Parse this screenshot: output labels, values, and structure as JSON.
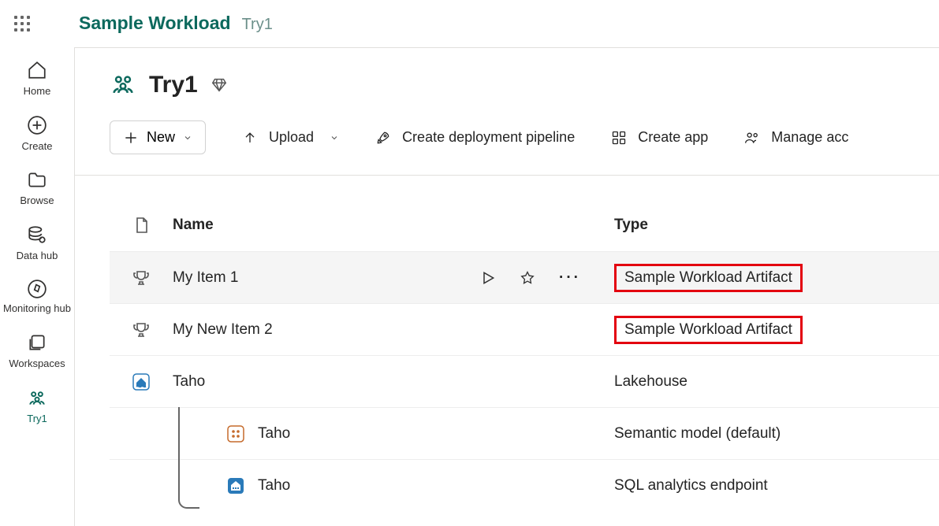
{
  "breadcrumb": {
    "main": "Sample Workload",
    "sub": "Try1"
  },
  "leftnav": {
    "home": "Home",
    "create": "Create",
    "browse": "Browse",
    "datahub": "Data hub",
    "monitoring": "Monitoring hub",
    "workspaces": "Workspaces",
    "try1": "Try1"
  },
  "workspace": {
    "title": "Try1"
  },
  "toolbar": {
    "new": "New",
    "upload": "Upload",
    "pipeline": "Create deployment pipeline",
    "createapp": "Create app",
    "manage": "Manage acc"
  },
  "table": {
    "headers": {
      "name": "Name",
      "type": "Type"
    },
    "rows": [
      {
        "name": "My Item 1",
        "type": "Sample Workload Artifact",
        "highlight": true,
        "hovered": true,
        "icon": "trophy"
      },
      {
        "name": "My New Item 2",
        "type": "Sample Workload Artifact",
        "highlight": true,
        "icon": "trophy"
      },
      {
        "name": "Taho",
        "type": "Lakehouse",
        "icon": "lakehouse"
      },
      {
        "name": "Taho",
        "type": "Semantic model (default)",
        "icon": "semantic",
        "child": true
      },
      {
        "name": "Taho",
        "type": "SQL analytics endpoint",
        "icon": "sql",
        "child": true
      }
    ]
  }
}
